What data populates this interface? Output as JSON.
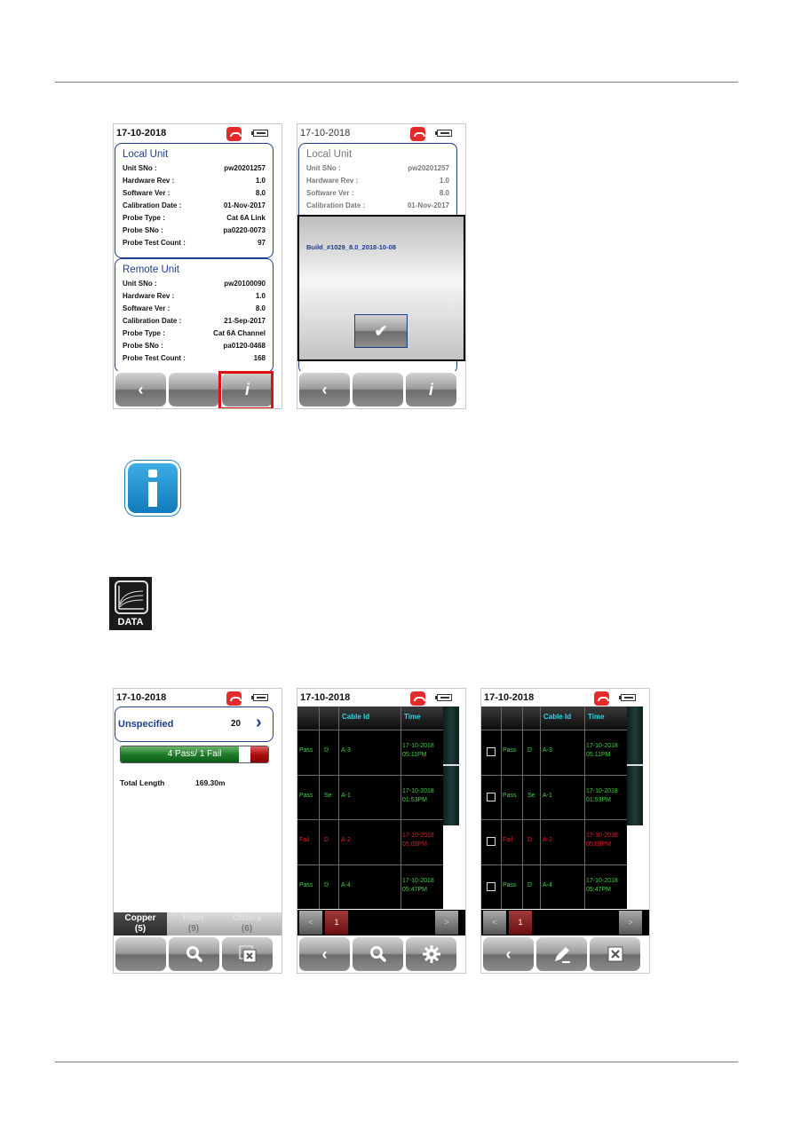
{
  "screens": {
    "info": {
      "date": "17-10-2018",
      "local": {
        "title": "Local Unit",
        "rows": [
          {
            "k": "Unit SNo :",
            "v": "pw20201257"
          },
          {
            "k": "Hardware Rev :",
            "v": "1.0"
          },
          {
            "k": "Software Ver :",
            "v": "8.0"
          },
          {
            "k": "Calibration Date :",
            "v": "01-Nov-2017"
          },
          {
            "k": "Probe Type :",
            "v": "Cat 6A Link"
          },
          {
            "k": "Probe SNo   :",
            "v": "pa0220-0073"
          },
          {
            "k": "Probe Test Count :",
            "v": "97"
          }
        ]
      },
      "remote": {
        "title": "Remote Unit",
        "rows": [
          {
            "k": "Unit SNo :",
            "v": "pw20100090"
          },
          {
            "k": "Hardware Rev :",
            "v": "1.0"
          },
          {
            "k": "Software Ver :",
            "v": "8.0"
          },
          {
            "k": "Calibration Date :",
            "v": "21-Sep-2017"
          },
          {
            "k": "Probe Type :",
            "v": "Cat 6A Channel"
          },
          {
            "k": "Probe SNo   :",
            "v": "pa0120-0468"
          },
          {
            "k": "Probe Test Count :",
            "v": "168"
          }
        ]
      },
      "buttons": {
        "back": "‹",
        "info": "i"
      }
    },
    "build": {
      "date": "17-10-2018",
      "local": {
        "title": "Local Unit",
        "rows": [
          {
            "k": "Unit SNo :",
            "v": "pw20201257"
          },
          {
            "k": "Hardware Rev :",
            "v": "1.0"
          },
          {
            "k": "Software Ver :",
            "v": "8.0"
          },
          {
            "k": "Calibration Date :",
            "v": "01-Nov-2017"
          }
        ]
      },
      "build_text": "Build_#1029_8.0_2018-10-08",
      "ok": "✔",
      "buttons": {
        "back": "‹",
        "info": "i"
      }
    },
    "summary": {
      "date": "17-10-2018",
      "group": {
        "name": "Unspecified",
        "count": "20",
        "chevron": "›"
      },
      "result": {
        "label": "4 Pass/ 1 Fail",
        "pass": 4,
        "fail": 1
      },
      "total_length": {
        "label": "Total Length",
        "value": "169.30m"
      },
      "tabs": [
        {
          "name": "Copper",
          "count": "(5)",
          "active": true
        },
        {
          "name": "Fiber",
          "count": "(9)",
          "active": false
        },
        {
          "name": "Others",
          "count": "(6)",
          "active": false
        }
      ],
      "buttons": {
        "search": "search-icon",
        "delete": "delete-icon"
      }
    },
    "list": {
      "date": "17-10-2018",
      "columns": [
        "",
        "",
        "Cable Id",
        "Time"
      ],
      "rows": [
        {
          "status": "Pass",
          "type": "D",
          "id": "A-3",
          "date": "17-10-2018",
          "time": "05:11PM"
        },
        {
          "status": "Pass",
          "type": "Se",
          "id": "A-1",
          "date": "17-10-2018",
          "time": "01:53PM"
        },
        {
          "status": "Fail",
          "type": "D",
          "id": "A-2",
          "date": "17-10-2018",
          "time": "05:09PM"
        },
        {
          "status": "Pass",
          "type": "D",
          "id": "A-4",
          "date": "17-10-2018",
          "time": "05:47PM"
        }
      ],
      "pager": {
        "prev": "<",
        "page": "1",
        "next": ">"
      },
      "buttons": {
        "back": "‹",
        "search": "search-icon",
        "settings": "gear-icon"
      }
    },
    "select": {
      "date": "17-10-2018",
      "columns": [
        "",
        "",
        "",
        "Cable Id",
        "Time"
      ],
      "rows": [
        {
          "status": "Pass",
          "type": "D",
          "id": "A-3",
          "date": "17-10-2018",
          "time": "05:11PM",
          "checked": false
        },
        {
          "status": "Pass",
          "type": "Se",
          "id": "A-1",
          "date": "17-10-2018",
          "time": "01:53PM",
          "checked": false
        },
        {
          "status": "Fail",
          "type": "D",
          "id": "A-2",
          "date": "17-10-2018",
          "time": "05:09PM",
          "checked": false
        },
        {
          "status": "Pass",
          "type": "D",
          "id": "A-4",
          "date": "17-10-2018",
          "time": "05:47PM",
          "checked": false
        }
      ],
      "pager": {
        "prev": "<",
        "page": "1",
        "next": ">"
      },
      "buttons": {
        "back": "‹",
        "edit": "pencil-icon",
        "delete": "delete-icon"
      }
    }
  },
  "icons": {
    "info_note": "info-icon",
    "data_app": "DATA"
  }
}
